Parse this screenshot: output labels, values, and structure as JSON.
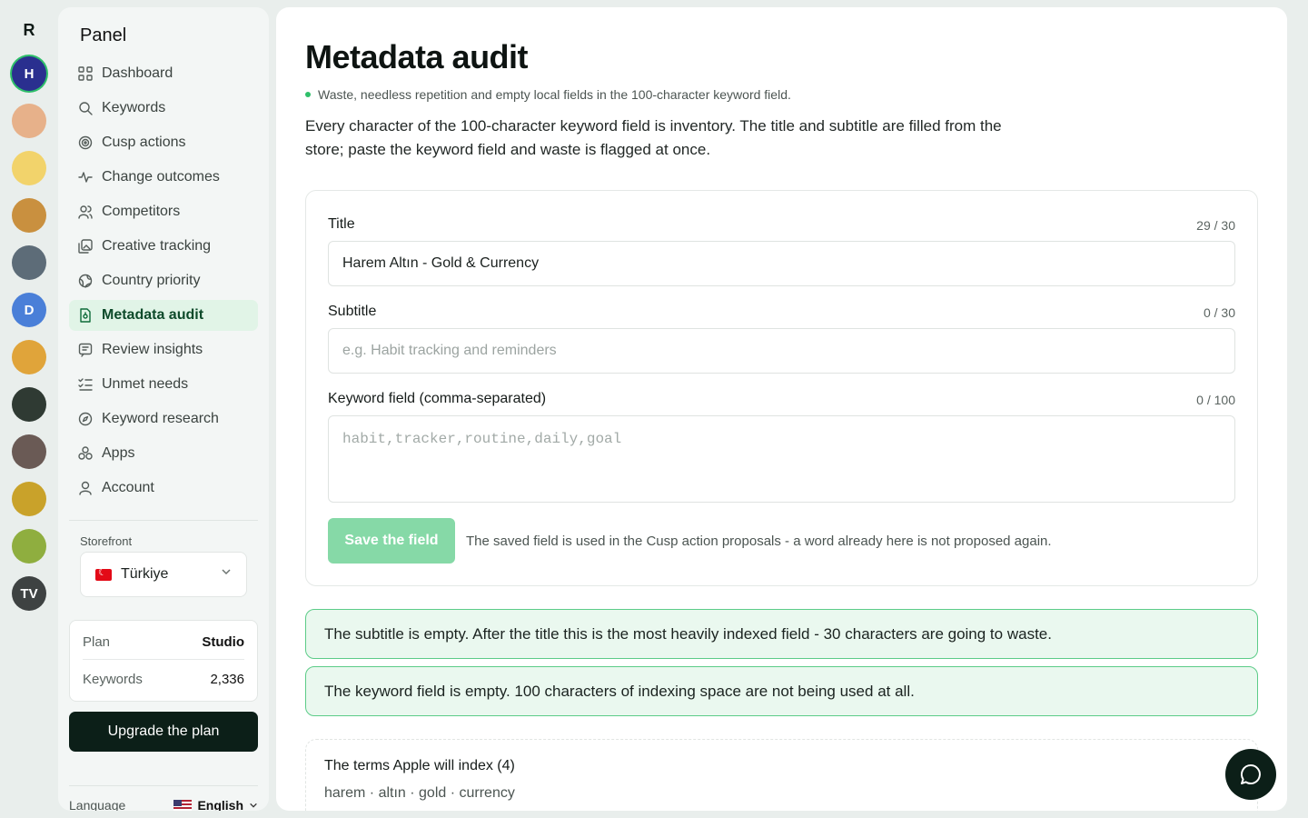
{
  "rail": {
    "logo": "R",
    "apps": [
      {
        "label": "H",
        "bg": "#2a2f8f",
        "active": true
      },
      {
        "label": "",
        "bg": "#e7b18a"
      },
      {
        "label": "",
        "bg": "#f2d36b"
      },
      {
        "label": "",
        "bg": "#c9903f"
      },
      {
        "label": "",
        "bg": "#5d6c78"
      },
      {
        "label": "D",
        "bg": "#4a7fd8"
      },
      {
        "label": "",
        "bg": "#e0a43a"
      },
      {
        "label": "",
        "bg": "#2f3a33"
      },
      {
        "label": "",
        "bg": "#6a5a55"
      },
      {
        "label": "",
        "bg": "#c9a22a"
      },
      {
        "label": "",
        "bg": "#8fae3f"
      },
      {
        "label": "TV",
        "bg": "#3e4242"
      }
    ]
  },
  "sidebar": {
    "title": "Panel",
    "nav": [
      {
        "label": "Dashboard",
        "icon": "grid-icon"
      },
      {
        "label": "Keywords",
        "icon": "search-icon"
      },
      {
        "label": "Cusp actions",
        "icon": "target-icon"
      },
      {
        "label": "Change outcomes",
        "icon": "pulse-icon"
      },
      {
        "label": "Competitors",
        "icon": "users-icon"
      },
      {
        "label": "Creative tracking",
        "icon": "image-icon"
      },
      {
        "label": "Country priority",
        "icon": "globe-icon"
      },
      {
        "label": "Metadata audit",
        "icon": "document-icon",
        "active": true
      },
      {
        "label": "Review insights",
        "icon": "message-icon"
      },
      {
        "label": "Unmet needs",
        "icon": "checklist-icon"
      },
      {
        "label": "Keyword research",
        "icon": "compass-icon"
      },
      {
        "label": "Apps",
        "icon": "apps-icon"
      },
      {
        "label": "Account",
        "icon": "user-icon"
      }
    ],
    "storefront_label": "Storefront",
    "storefront_value": "Türkiye",
    "plan": {
      "label": "Plan",
      "value": "Studio"
    },
    "keywords": {
      "label": "Keywords",
      "value": "2,336"
    },
    "upgrade_label": "Upgrade the plan",
    "language_label": "Language",
    "language_value": "English"
  },
  "main": {
    "title": "Metadata audit",
    "subtitle": "Waste, needless repetition and empty local fields in the 100-character keyword field.",
    "intro": "Every character of the 100-character keyword field is inventory. The title and subtitle are filled from the store; paste the keyword field and waste is flagged at once.",
    "form": {
      "title_label": "Title",
      "title_count": "29 / 30",
      "title_value": "Harem Altın - Gold & Currency",
      "subtitle_label": "Subtitle",
      "subtitle_count": "0 / 30",
      "subtitle_placeholder": "e.g. Habit tracking and reminders",
      "keyword_label": "Keyword field (comma-separated)",
      "keyword_count": "0 / 100",
      "keyword_placeholder": "habit,tracker,routine,daily,goal",
      "save_label": "Save the field",
      "save_note": "The saved field is used in the Cusp action proposals - a word already here is not proposed again."
    },
    "alerts": [
      "The subtitle is empty. After the title this is the most heavily indexed field - 30 characters are going to waste.",
      "The keyword field is empty. 100 characters of indexing space are not being used at all."
    ],
    "index": {
      "title": "The terms Apple will index (4)",
      "terms": "harem · altın · gold · currency"
    }
  }
}
